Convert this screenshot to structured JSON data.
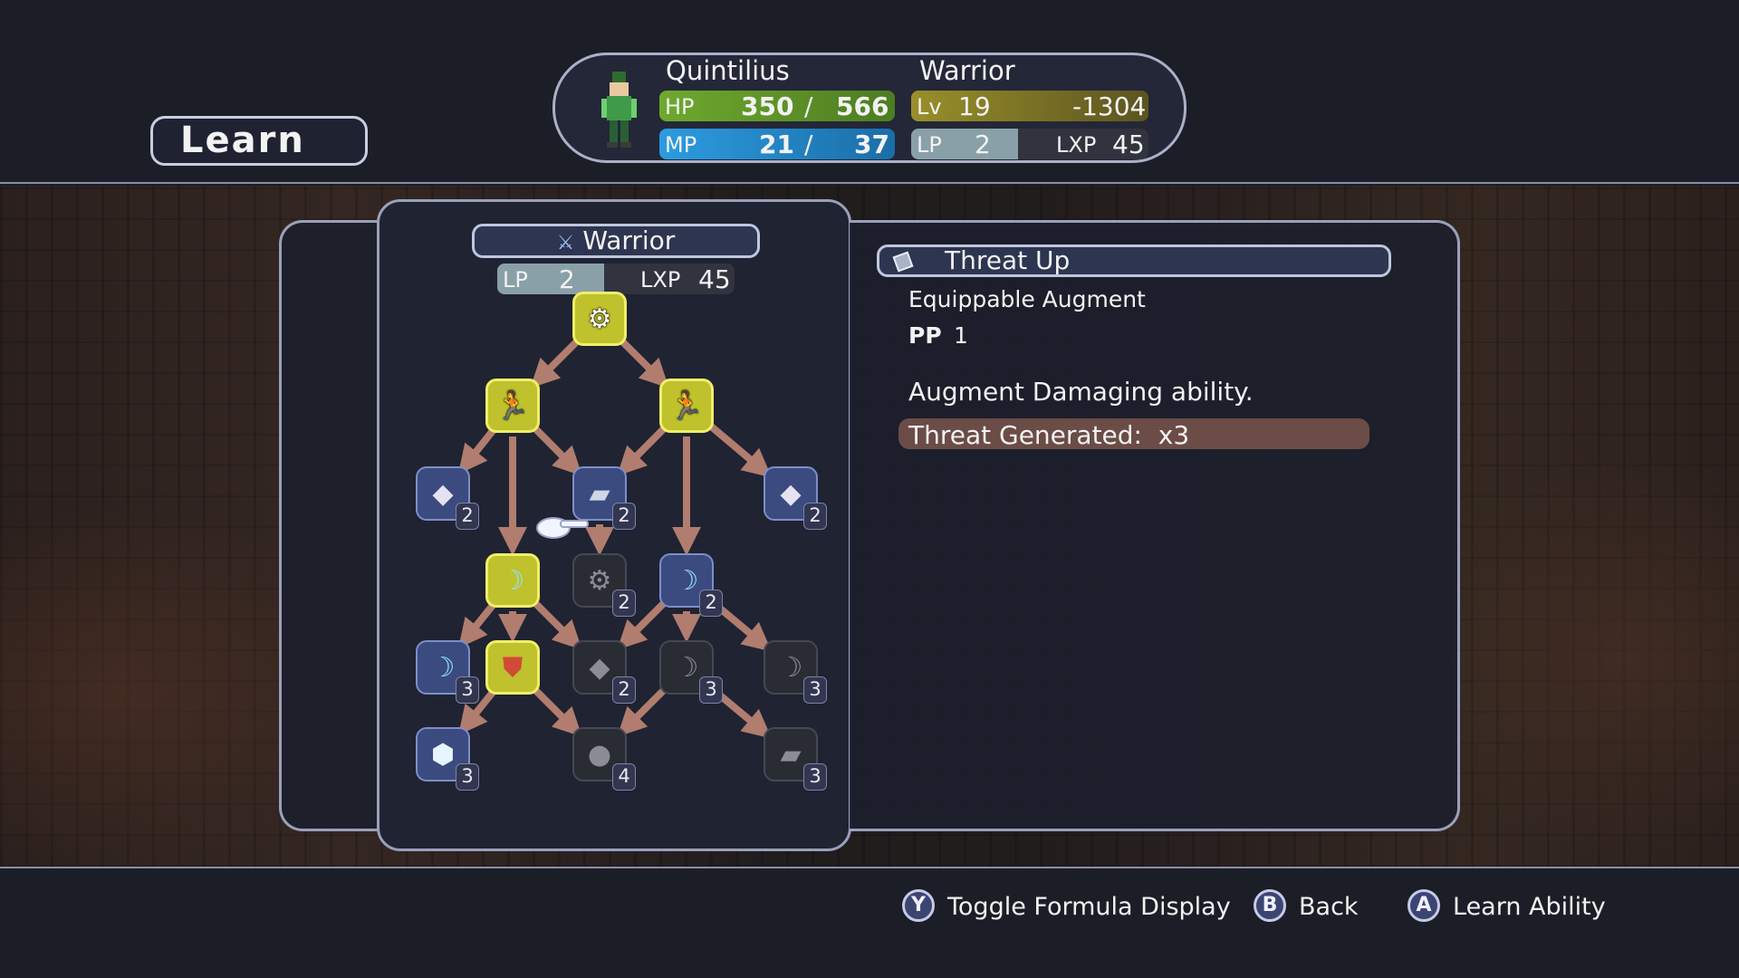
{
  "screen": {
    "title": "Learn"
  },
  "character": {
    "name": "Quintilius",
    "job": "Warrior",
    "hp_label": "HP",
    "hp_current": "350",
    "hp_separator": "/",
    "hp_max": "566",
    "mp_label": "MP",
    "mp_current": "21",
    "mp_separator": "/",
    "mp_max": "37",
    "lv_label": "Lv",
    "level": "19",
    "exp_to_next": "-1304",
    "lp_label": "LP",
    "lp": "2",
    "lxp_label": "LXP",
    "lxp": "45"
  },
  "tree": {
    "job_name": "Warrior",
    "lp_label": "LP",
    "lp": "2",
    "lxp_label": "LXP",
    "lxp": "45",
    "nodes": [
      {
        "id": "n0",
        "icon": "cog-icon",
        "state": "learned",
        "cost": ""
      },
      {
        "id": "n1",
        "icon": "runner-icon",
        "state": "learned",
        "cost": ""
      },
      {
        "id": "n2",
        "icon": "runner-icon",
        "state": "learned",
        "cost": ""
      },
      {
        "id": "n3",
        "icon": "gem-icon",
        "state": "avail",
        "cost": "2"
      },
      {
        "id": "n4",
        "icon": "augment-icon",
        "state": "avail",
        "cost": "2"
      },
      {
        "id": "n5",
        "icon": "gem-icon",
        "state": "avail",
        "cost": "2"
      },
      {
        "id": "n6",
        "icon": "slash-icon",
        "state": "learned",
        "cost": ""
      },
      {
        "id": "n7",
        "icon": "cog-icon",
        "state": "locked",
        "cost": "2"
      },
      {
        "id": "n8",
        "icon": "slash-icon",
        "state": "avail",
        "cost": "2"
      },
      {
        "id": "n9",
        "icon": "slash-icon",
        "state": "avail",
        "cost": "3"
      },
      {
        "id": "n10",
        "icon": "shield-icon",
        "state": "learned",
        "cost": ""
      },
      {
        "id": "n11",
        "icon": "gem-icon",
        "state": "locked",
        "cost": "2"
      },
      {
        "id": "n12",
        "icon": "slash-icon",
        "state": "locked",
        "cost": "3"
      },
      {
        "id": "n13",
        "icon": "slash-icon",
        "state": "locked",
        "cost": "3"
      },
      {
        "id": "n14",
        "icon": "crystal-icon",
        "state": "avail",
        "cost": "3"
      },
      {
        "id": "n15",
        "icon": "orb-icon",
        "state": "locked",
        "cost": "4"
      },
      {
        "id": "n16",
        "icon": "augment-icon",
        "state": "locked",
        "cost": "3"
      }
    ]
  },
  "ability": {
    "name": "Threat Up",
    "icon": "augment-icon",
    "type": "Equippable Augment",
    "pp_label": "PP",
    "pp_value": "1",
    "description": "Augment Damaging ability.",
    "effect": "Threat Generated:  x3"
  },
  "controls": [
    {
      "button": "Y",
      "label": "Toggle Formula Display"
    },
    {
      "button": "B",
      "label": "Back"
    },
    {
      "button": "A",
      "label": "Learn Ability"
    }
  ],
  "colors": {
    "learned": "#bfc12d",
    "available": "#3b4b80",
    "locked": "#2a2c33",
    "hp_bar": "#6f9d2e",
    "mp_bar": "#1f8fd0",
    "lv_bar": "#7d7520",
    "arrow": "#b07d6e"
  }
}
